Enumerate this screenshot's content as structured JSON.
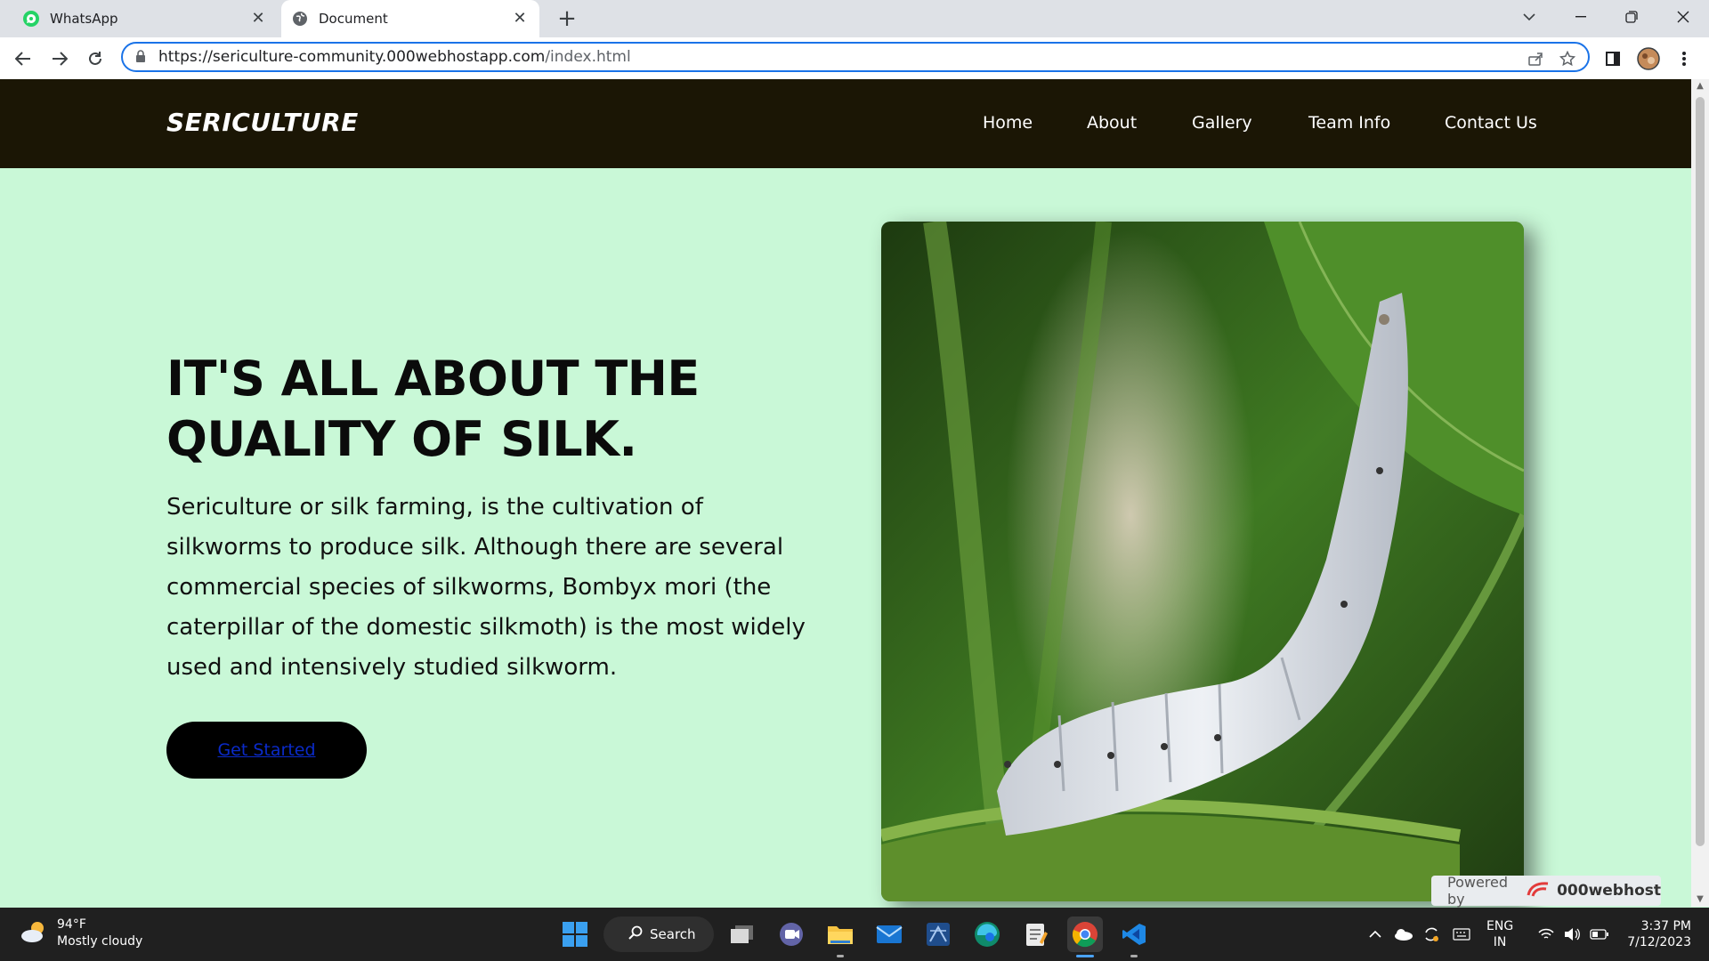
{
  "browser": {
    "tabs": [
      {
        "title": "WhatsApp",
        "icon": "whatsapp-icon",
        "active": false
      },
      {
        "title": "Document",
        "icon": "globe-icon",
        "active": true
      }
    ],
    "url_host": "https://sericulture-community.000webhostapp.com",
    "url_path": "/index.html"
  },
  "site": {
    "logo": "SERICULTURE",
    "nav": [
      "Home",
      "About",
      "Gallery",
      "Team Info",
      "Contact Us"
    ],
    "hero": {
      "title_line1": "IT'S ALL ABOUT THE",
      "title_line2": "QUALITY OF SILK.",
      "text": "Sericulture or silk farming, is the cultivation of silkworms to produce silk. Although there are several commercial species of silkworms, Bombyx mori (the caterpillar of the domestic silkmoth) is the most widely used and intensively studied silkworm.",
      "cta": "Get Started",
      "image_subject": "silkworm-on-mulberry-branch"
    },
    "powered_label": "Powered by",
    "powered_brand": "000webhost",
    "colors": {
      "nav_bg": "#1b1605",
      "page_bg": "#c9f8d7",
      "cta_bg": "#000000",
      "cta_text": "#0a2ac9"
    }
  },
  "taskbar": {
    "weather_temp": "94°F",
    "weather_desc": "Mostly cloudy",
    "search_label": "Search",
    "lang_line1": "ENG",
    "lang_line2": "IN",
    "time": "3:37 PM",
    "date": "7/12/2023"
  }
}
